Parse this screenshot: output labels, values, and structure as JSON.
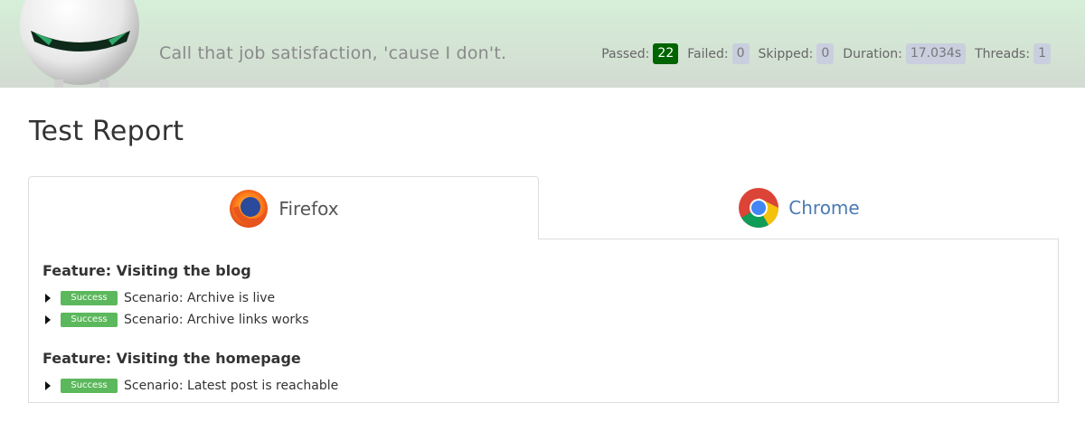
{
  "header": {
    "tagline": "Call that job satisfaction, 'cause I don't.",
    "stats": [
      {
        "label": "Passed:",
        "value": "22"
      },
      {
        "label": "Failed:",
        "value": "0"
      },
      {
        "label": "Skipped:",
        "value": "0"
      },
      {
        "label": "Duration:",
        "value": "17.034s"
      },
      {
        "label": "Threads:",
        "value": "1"
      }
    ],
    "mascot_icon": "robot-mascot-icon"
  },
  "page": {
    "title": "Test Report"
  },
  "tabs": [
    {
      "label": "Firefox",
      "icon": "firefox-icon",
      "active": true
    },
    {
      "label": "Chrome",
      "icon": "chrome-icon",
      "active": false
    }
  ],
  "features": [
    {
      "title": "Feature: Visiting the blog",
      "scenarios": [
        {
          "status": "Success",
          "name": "Scenario: Archive is live"
        },
        {
          "status": "Success",
          "name": "Scenario: Archive links works"
        }
      ]
    },
    {
      "title": "Feature: Visiting the homepage",
      "scenarios": [
        {
          "status": "Success",
          "name": "Scenario: Latest post is reachable"
        }
      ]
    }
  ],
  "colors": {
    "passed_badge": "#006400",
    "neutral_badge": "#c9cfdf",
    "success_label": "#5cb85c",
    "link_tab": "#4a7ab3"
  }
}
